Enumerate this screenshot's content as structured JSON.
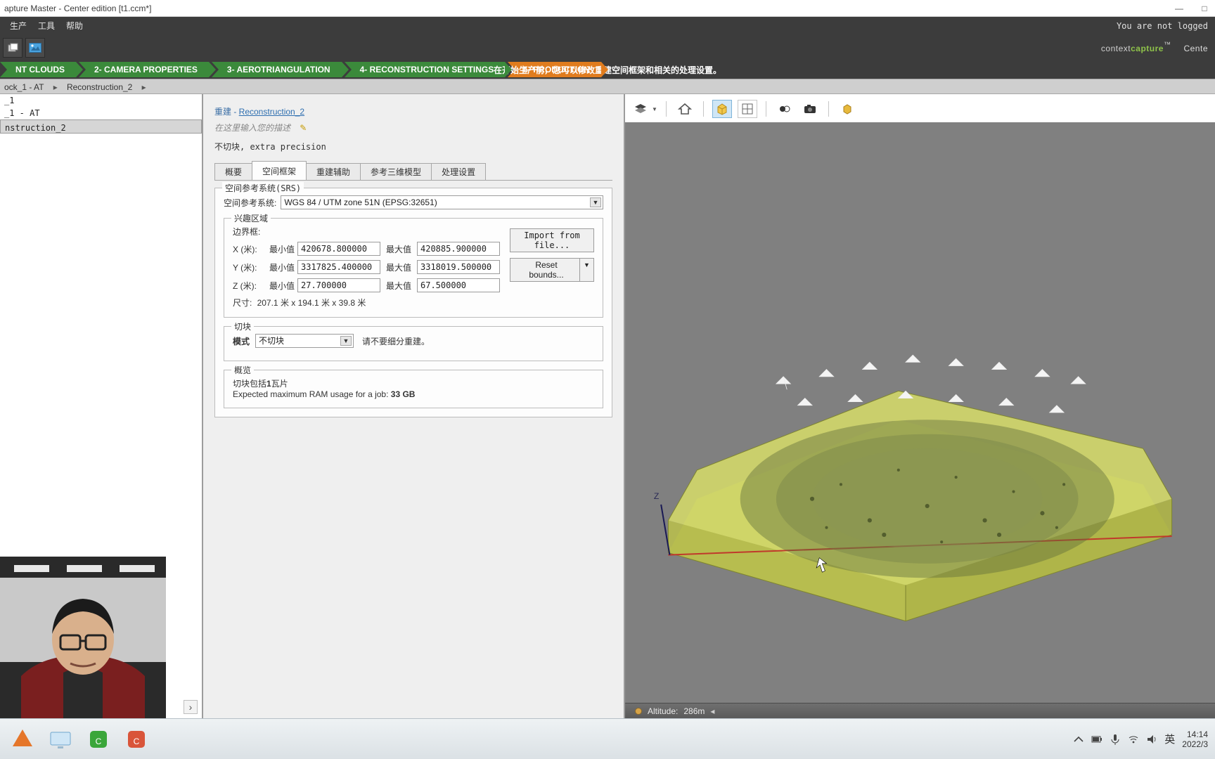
{
  "window": {
    "title": "apture Master - Center edition [t1.ccm*]",
    "minimize": "—",
    "maximize": "□",
    "brand_pre": "context",
    "brand_bold": "capture",
    "brand_tm": "™",
    "brand_right": "Cente",
    "not_logged": "You are not logged"
  },
  "menu": [
    "生产",
    "工具",
    "帮助"
  ],
  "menu_lead": "",
  "steps": [
    {
      "label": "NT CLOUDS",
      "cls": "green"
    },
    {
      "label": "2- CAMERA PROPERTIES",
      "cls": "green"
    },
    {
      "label": "3- AEROTRIANGULATION",
      "cls": "green"
    },
    {
      "label": "4- RECONSTRUCTION SETTINGS",
      "cls": "green"
    },
    {
      "label": "5- PRODUCTION",
      "cls": "orange"
    }
  ],
  "step_tip": "在开始生产前，您可以修改重建空间框架和相关的处理设置。",
  "breadcrumb": {
    "a": "ock_1 - AT",
    "b": "Reconstruction_2"
  },
  "tree": [
    {
      "label": "_1",
      "sel": false
    },
    {
      "label": "_1 - AT",
      "sel": false
    },
    {
      "label": "nstruction_2",
      "sel": true
    }
  ],
  "form": {
    "heading_prefix": "重建 - ",
    "heading_link": "Reconstruction_2",
    "desc_placeholder": "在这里输入您的描述",
    "precision": "不切块, extra precision",
    "tabs": [
      "概要",
      "空间框架",
      "重建辅助",
      "参考三维模型",
      "处理设置"
    ],
    "active_tab": 1,
    "srs": {
      "group": "空间参考系统(SRS)",
      "label": "空间参考系统:",
      "value": "WGS 84 / UTM zone 51N (EPSG:32651)"
    },
    "roi": {
      "group": "兴趣区域",
      "bbox_label": "边界框:",
      "rows": [
        {
          "axis": "X (米):",
          "minl": "最小值",
          "min": "420678.800000",
          "maxl": "最大值",
          "max": "420885.900000"
        },
        {
          "axis": "Y (米):",
          "minl": "最小值",
          "min": "3317825.400000",
          "maxl": "最大值",
          "max": "3318019.500000"
        },
        {
          "axis": "Z (米):",
          "minl": "最小值",
          "min": "27.700000",
          "maxl": "最大值",
          "max": "67.500000"
        }
      ],
      "size_label": "尺寸:",
      "size_value": "207.1 米 x 194.1 米 x 39.8 米",
      "import": "Import from file...",
      "reset": "Reset bounds..."
    },
    "tiling": {
      "group": "切块",
      "mode_label": "模式",
      "mode_value": "不切块",
      "mode_hint": "请不要细分重建。"
    },
    "preview": {
      "group": "概览",
      "line1_a": "切块包括",
      "line1_b": "1",
      "line1_c": "瓦片",
      "line2_a": "Expected maximum RAM usage for a job:",
      "line2_b": "33 GB"
    }
  },
  "viewer": {
    "toolbar_icons": [
      "layers",
      "home",
      "box",
      "grid",
      "exposure",
      "camera",
      "gold-box"
    ],
    "altitude_label": "Altitude:",
    "altitude_value": "286m",
    "axis_z": "Z"
  },
  "taskbar": {
    "time": "14:14",
    "date": "2022/3",
    "ime": "英"
  }
}
